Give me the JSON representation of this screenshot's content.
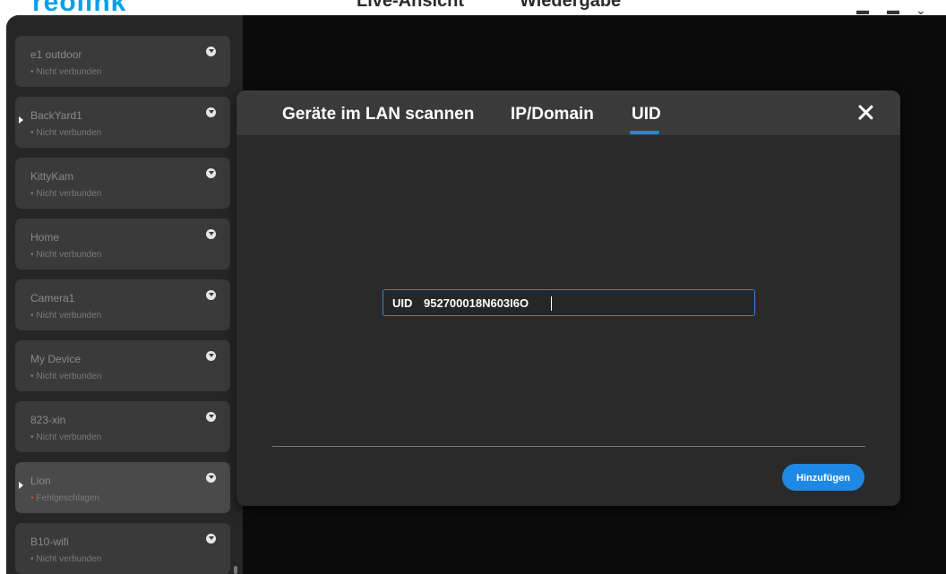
{
  "header": {
    "logo": "reolink",
    "tabs": [
      {
        "label": "Live-Ansicht",
        "active": true
      },
      {
        "label": "Wiedergabe",
        "active": false
      }
    ]
  },
  "devices": [
    {
      "name": "e1 outdoor",
      "status": "Nicht verbunden",
      "status_type": "disconnected",
      "selected": false
    },
    {
      "name": "BackYard1",
      "status": "Nicht verbunden",
      "status_type": "disconnected",
      "selected": true
    },
    {
      "name": "KittyKam",
      "status": "Nicht verbunden",
      "status_type": "disconnected",
      "selected": false
    },
    {
      "name": "Home",
      "status": "Nicht verbunden",
      "status_type": "disconnected",
      "selected": false
    },
    {
      "name": "Camera1",
      "status": "Nicht verbunden",
      "status_type": "disconnected",
      "selected": false
    },
    {
      "name": "My Device",
      "status": "Nicht verbunden",
      "status_type": "disconnected",
      "selected": false
    },
    {
      "name": "823-xin",
      "status": "Nicht verbunden",
      "status_type": "disconnected",
      "selected": false
    },
    {
      "name": "Lion",
      "status": "Fehlgeschlagen",
      "status_type": "failed",
      "selected": true
    },
    {
      "name": "B10-wifi",
      "status": "Nicht verbunden",
      "status_type": "disconnected",
      "selected": false
    }
  ],
  "modal": {
    "tabs": [
      {
        "label": "Geräte im LAN scannen",
        "active": false
      },
      {
        "label": "IP/Domain",
        "active": false
      },
      {
        "label": "UID",
        "active": true
      }
    ],
    "uid_label": "UID",
    "uid_value": "952700018N603I6O",
    "add_button": "Hinzufügen"
  },
  "colors": {
    "accent": "#1e88e5",
    "failed_dot": "#e53935",
    "background": "#0b0b0b",
    "sidebar": "#262626",
    "modal": "#2a2a2a"
  }
}
